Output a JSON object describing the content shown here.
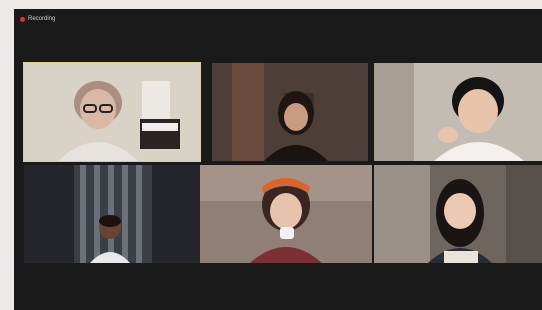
{
  "window": {
    "recording_label": "Recording"
  },
  "participants": [
    {
      "name": "",
      "active": true,
      "bg": "#cfc7bd",
      "figure": "woman-glasses"
    },
    {
      "name": "",
      "active": false,
      "bg": "#4a3b36",
      "figure": "girl-dark-hair"
    },
    {
      "name": "",
      "active": false,
      "bg": "#b7b1a9",
      "figure": "boy-dark-hair"
    },
    {
      "name": "",
      "active": false,
      "bg": "#2a2c31",
      "figure": "boy-small"
    },
    {
      "name": "",
      "active": false,
      "bg": "#8f7d72",
      "figure": "girl-orange-headband"
    },
    {
      "name": "",
      "active": false,
      "bg": "#6f6760",
      "figure": "girl-long-hair"
    }
  ],
  "colors": {
    "active_border": "#d8d48a",
    "window_bg": "#1a1a1a",
    "record_dot": "#e0312b"
  }
}
